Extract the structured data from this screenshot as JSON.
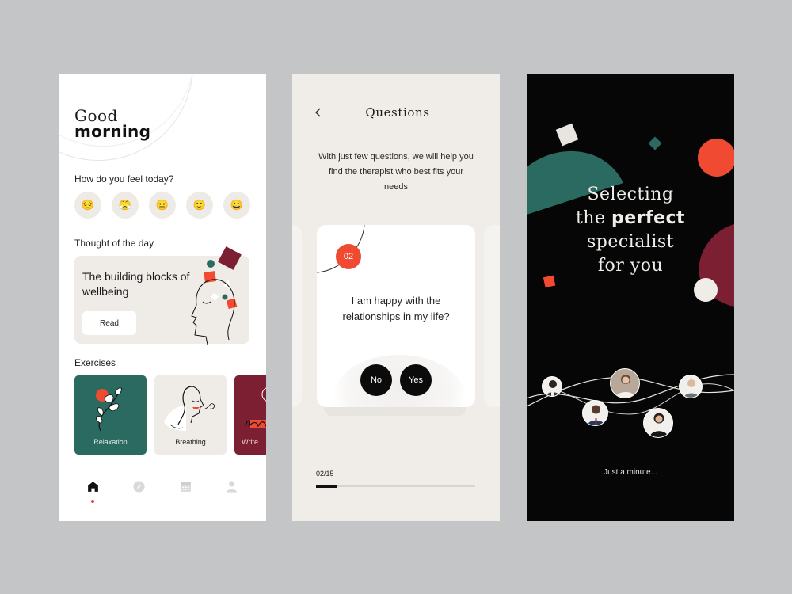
{
  "colors": {
    "background": "#c3c5c7",
    "accent_red": "#f04a32",
    "teal": "#2b6a60",
    "maroon": "#7d1f33",
    "beige": "#efece8",
    "black": "#060606"
  },
  "home": {
    "greeting_line1": "Good",
    "greeting_line2": "morning",
    "mood_prompt": "How do you feel today?",
    "moods": [
      {
        "name": "sad",
        "glyph": "😔"
      },
      {
        "name": "angry",
        "glyph": "😤"
      },
      {
        "name": "neutral",
        "glyph": "😐"
      },
      {
        "name": "slightly-happy",
        "glyph": "🙂"
      },
      {
        "name": "happy",
        "glyph": "😀"
      }
    ],
    "thought_heading": "Thought of the day",
    "thought_title": "The building blocks of wellbeing",
    "read_label": "Read",
    "exercises_heading": "Exercises",
    "exercises": [
      {
        "label": "Relaxation",
        "icon": "leaf-branch-icon"
      },
      {
        "label": "Breathing",
        "icon": "breathing-face-icon"
      },
      {
        "label": "Write",
        "icon": "writing-icon"
      }
    ],
    "nav": [
      {
        "name": "home",
        "icon": "home-icon",
        "active": true
      },
      {
        "name": "explore",
        "icon": "compass-icon",
        "active": false
      },
      {
        "name": "calendar",
        "icon": "calendar-icon",
        "active": false
      },
      {
        "name": "profile",
        "icon": "user-icon",
        "active": false
      }
    ]
  },
  "questions": {
    "back_icon": "chevron-left-icon",
    "title": "Questions",
    "intro": "With just few questions, we will help you find the therapist who best fits your needs",
    "question_number": "02",
    "question_text": "I am happy with the relationships in my life?",
    "answer_no": "No",
    "answer_yes": "Yes",
    "progress_label": "02/15",
    "progress_current": 2,
    "progress_total": 15
  },
  "matching": {
    "title_line1": "Selecting",
    "title_line2_prefix": "the ",
    "title_line2_bold": "perfect",
    "title_line3": "specialist",
    "title_line4": "for you",
    "status": "Just a minute...",
    "specialists": [
      {
        "name": "specialist-1"
      },
      {
        "name": "specialist-2"
      },
      {
        "name": "specialist-3"
      },
      {
        "name": "specialist-4"
      },
      {
        "name": "specialist-5"
      }
    ]
  }
}
